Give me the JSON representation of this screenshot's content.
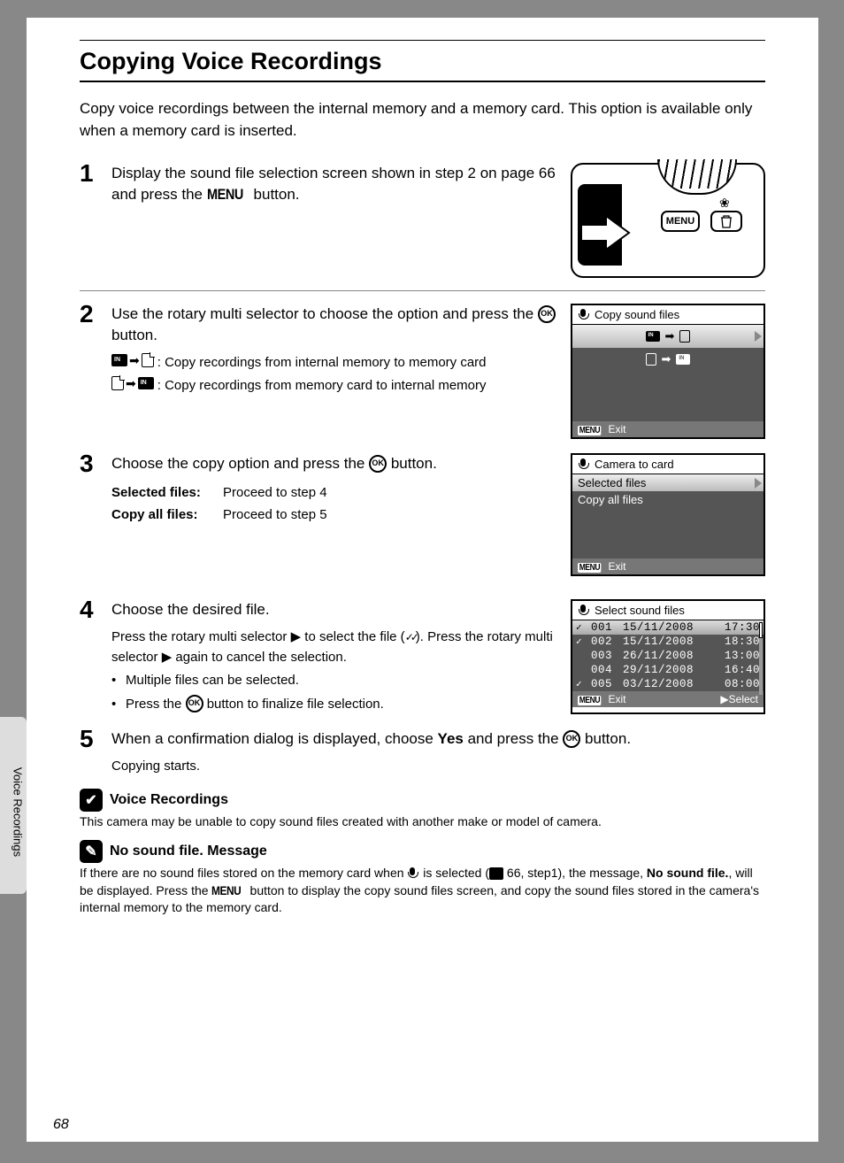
{
  "sidebar_label": "Voice Recordings",
  "page_number": "68",
  "title": "Copying Voice Recordings",
  "intro": "Copy voice recordings between the internal memory and a memory card. This option is available only when a memory card is inserted.",
  "step1": {
    "num": "1",
    "text_a": "Display the sound file selection screen shown in step 2 on page 66 and press the ",
    "menu": "MENU",
    "text_b": " button.",
    "cam_menu": "MENU"
  },
  "step2": {
    "num": "2",
    "main_a": "Use the rotary multi selector to choose the option and press the ",
    "ok": "OK",
    "main_b": " button.",
    "opt1": ": Copy recordings from internal memory to memory card",
    "opt2": ": Copy recordings from memory card to internal memory",
    "lcd_title": "Copy sound files",
    "lcd_exit": "Exit",
    "lcd_menu": "MENU"
  },
  "step3": {
    "num": "3",
    "main_a": "Choose the copy option and press the ",
    "ok": "OK",
    "main_b": " button.",
    "row1_label": "Selected files",
    "row1_val": "Proceed to step 4",
    "row2_label": "Copy all files",
    "row2_val": "Proceed to step 5",
    "lcd_title": "Camera to card",
    "lcd_opt1": "Selected files",
    "lcd_opt2": "Copy all files",
    "lcd_exit": "Exit",
    "lcd_menu": "MENU"
  },
  "step4": {
    "num": "4",
    "main": "Choose the desired file.",
    "sub_a": "Press the rotary multi selector ",
    "sub_b": " to select the file (",
    "sub_c": "). Press the rotary multi selector ",
    "sub_d": " again to cancel the selection.",
    "bullet1": "Multiple files can be selected.",
    "bullet2_a": "Press the ",
    "bullet2_b": " button to finalize file selection.",
    "ok": "OK",
    "lcd_title": "Select sound files",
    "files": [
      {
        "chk": true,
        "num": "001",
        "date": "15/11/2008",
        "time": "17:30",
        "hl": true
      },
      {
        "chk": true,
        "num": "002",
        "date": "15/11/2008",
        "time": "18:30",
        "hl": false
      },
      {
        "chk": false,
        "num": "003",
        "date": "26/11/2008",
        "time": "13:00",
        "hl": false
      },
      {
        "chk": false,
        "num": "004",
        "date": "29/11/2008",
        "time": "16:40",
        "hl": false
      },
      {
        "chk": true,
        "num": "005",
        "date": "03/12/2008",
        "time": "08:00",
        "hl": false
      }
    ],
    "lcd_exit": "Exit",
    "lcd_select": "Select",
    "lcd_menu": "MENU"
  },
  "step5": {
    "num": "5",
    "text_a": "When a confirmation dialog is displayed, choose ",
    "yes": "Yes",
    "text_b": " and press the ",
    "ok": "OK",
    "text_c": " button.",
    "sub": "Copying starts."
  },
  "note1": {
    "title": "Voice Recordings",
    "body": "This camera may be unable to copy sound files created with another make or model of camera."
  },
  "note2": {
    "title": "No sound file. Message",
    "body_a": "If there are no sound files stored on the memory card when ",
    "body_b": " is selected (",
    "body_c": " 66, step1), the message, ",
    "bold": "No sound file.",
    "body_d": ", will be displayed. Press the ",
    "menu": "MENU",
    "body_e": " button to display the copy sound files screen, and copy the sound files stored in the camera's internal memory to the memory card."
  }
}
